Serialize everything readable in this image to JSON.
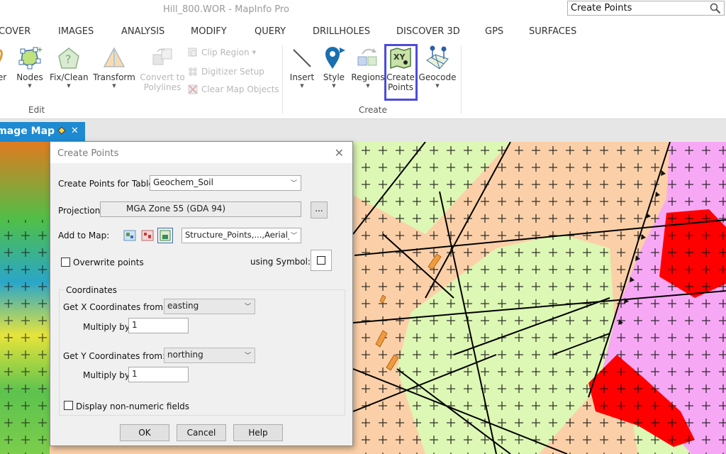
{
  "window": {
    "title": "Hill_800.WOR - MapInfo Pro"
  },
  "search": {
    "value": "Create Points"
  },
  "tabs": [
    "DISCOVER",
    "IMAGES",
    "ANALYSIS",
    "MODIFY",
    "QUERY",
    "DRILLHOLES",
    "DISCOVER 3D",
    "GPS",
    "SURFACES"
  ],
  "tabs_visible": [
    "COVER",
    "IMAGES",
    "ANALYSIS",
    "MODIFY",
    "QUERY",
    "DRILLHOLES",
    "DISCOVER 3D",
    "GPS",
    "SURFACES"
  ],
  "ribbon": {
    "edit_group": {
      "label": "Edit",
      "cut_label": "er",
      "nodes": "Nodes",
      "fixclean": "Fix/Clean",
      "transform": "Transform",
      "convert_line1": "Convert to",
      "convert_line2": "Polylines",
      "clip_region": "Clip Region",
      "digitizer_setup": "Digitizer Setup",
      "clear_map_objects": "Clear Map Objects"
    },
    "create_group": {
      "label": "Create",
      "insert": "Insert",
      "style": "Style",
      "regions": "Regions",
      "create_points_line1": "Create",
      "create_points_line2": "Points",
      "geocode": "Geocode"
    },
    "highlight_color": "#4d4bdc"
  },
  "doc_tab": {
    "label": "Image Map",
    "visible_label": "Image Map",
    "close": "✕"
  },
  "dialog": {
    "title": "Create Points",
    "table_label": "Create Points for Table:",
    "table_value": "Geochem_Soil",
    "projection_label": "Projection:",
    "projection_value": "MGA Zone 55 (GDA 94)",
    "projection_button": "...",
    "add_to_map_label": "Add to Map:",
    "add_to_map_value": "Structure_Points,...,Aerial_I",
    "overwrite_label": "Overwrite points",
    "using_symbol_label": "using Symbol:",
    "coordinates_group": "Coordinates",
    "x_label": "Get X Coordinates from:",
    "x_value": "easting",
    "x_multiply_label": "Multiply by:",
    "x_multiply_value": "1",
    "y_label": "Get Y Coordinates from:",
    "y_value": "northing",
    "y_multiply_label": "Multiply by:",
    "y_multiply_value": "1",
    "non_numeric_label": "Display non-numeric fields",
    "ok": "OK",
    "cancel": "Cancel",
    "help": "Help"
  },
  "map_colors": {
    "peach": "#fbd0a8",
    "lightgreen": "#ddf7b4",
    "pink": "#f7a8f5",
    "red": "#ff0000",
    "raster_green": "#4cc24a"
  }
}
